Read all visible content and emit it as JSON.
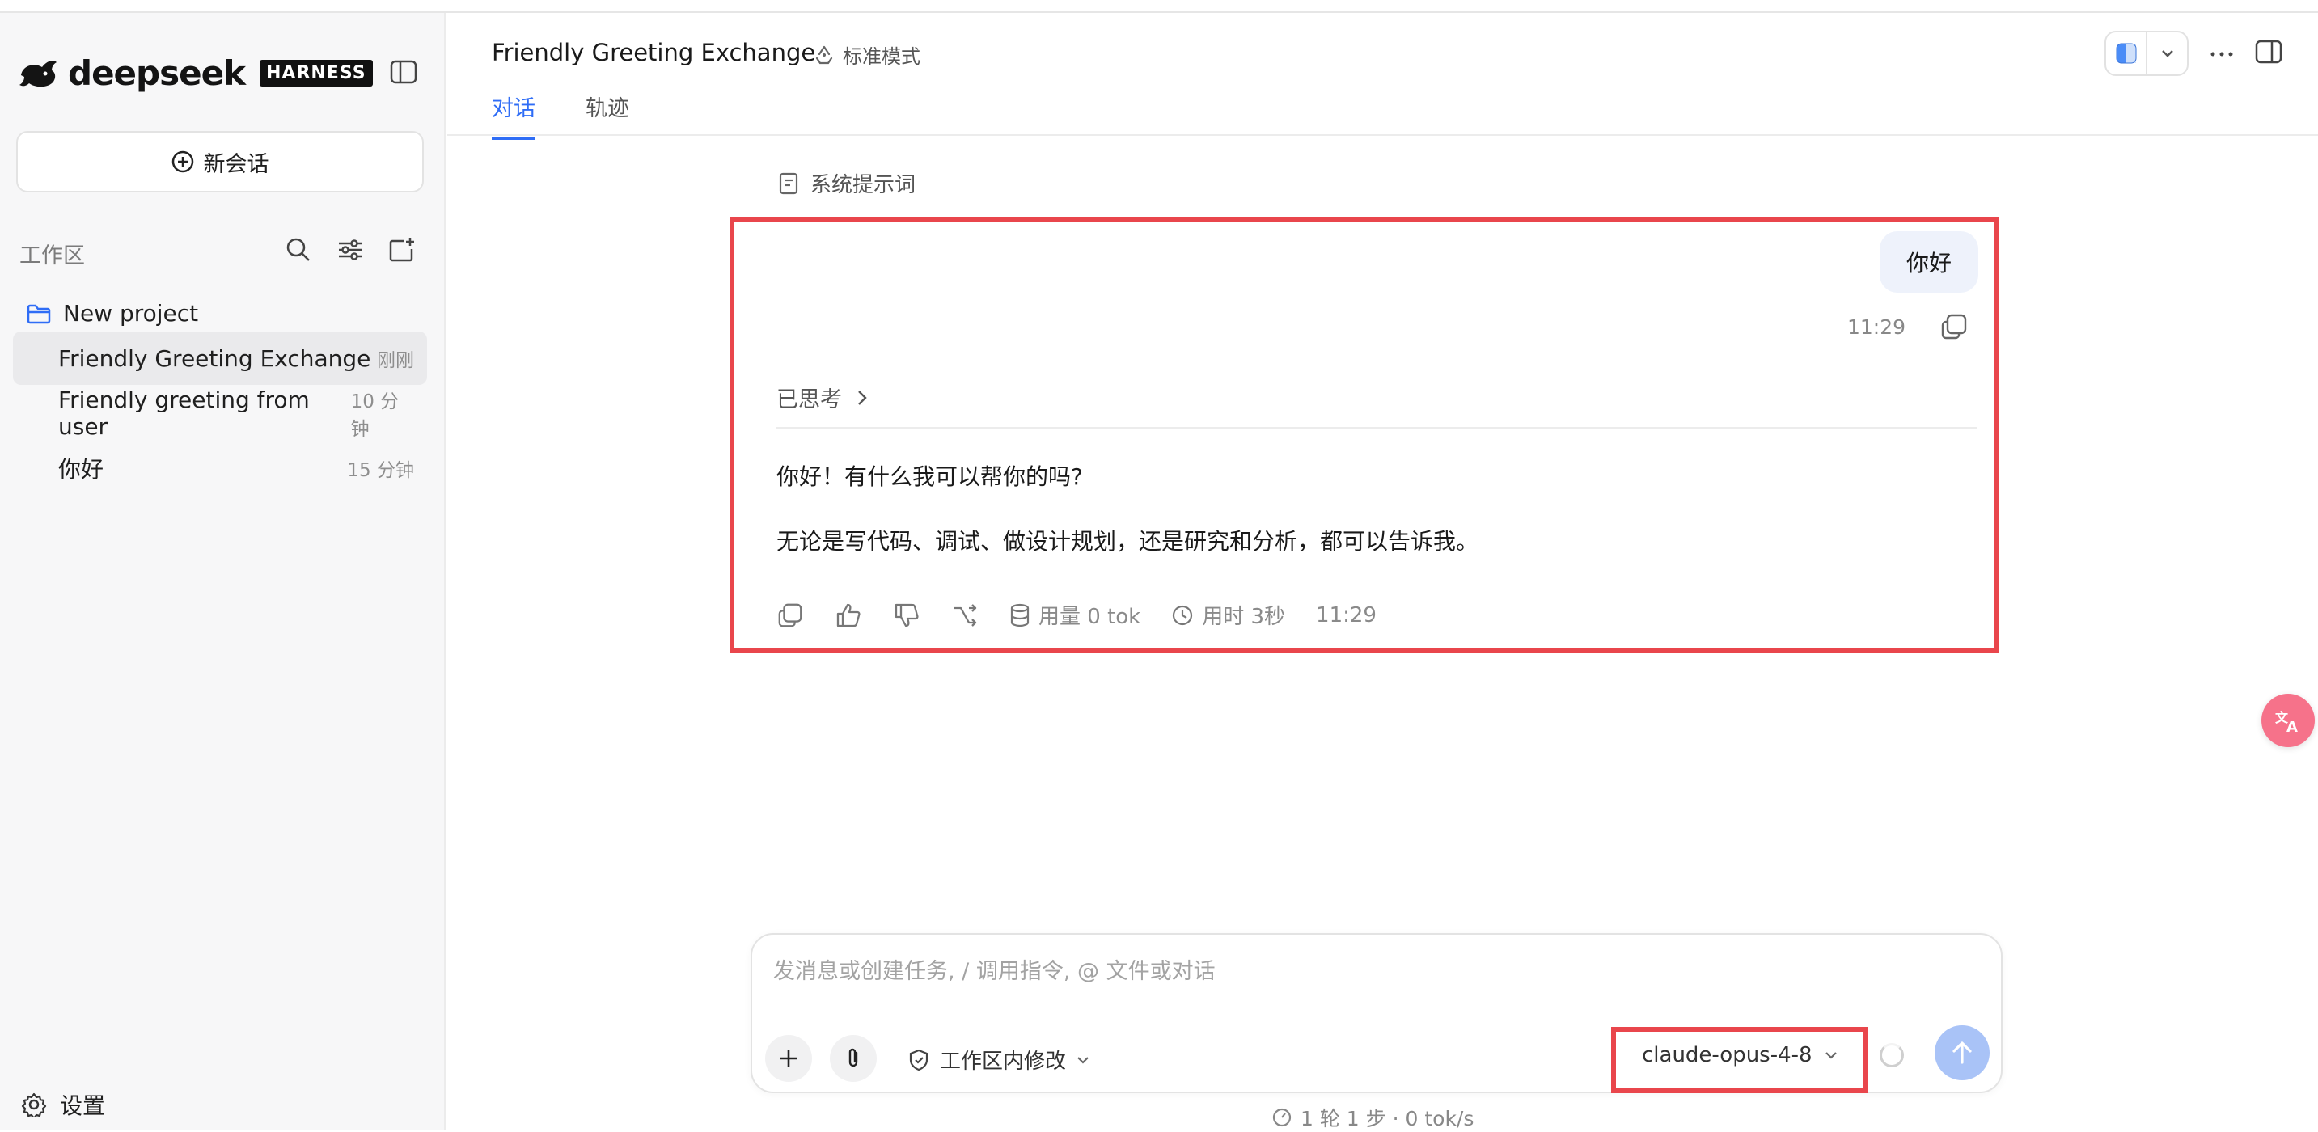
{
  "sidebar": {
    "logo_text": "deepseek",
    "logo_badge": "HARNESS",
    "new_chat_label": "新会话",
    "workspace_label": "工作区",
    "project_name": "New project",
    "conversations": [
      {
        "title": "Friendly Greeting Exchange",
        "time": "刚刚",
        "active": true
      },
      {
        "title": "Friendly greeting from user",
        "time": "10 分钟",
        "active": false
      },
      {
        "title": "你好",
        "time": "15 分钟",
        "active": false
      }
    ],
    "settings_label": "设置"
  },
  "header": {
    "title": "Friendly Greeting Exchange",
    "mode_label": "标准模式",
    "tabs": [
      {
        "label": "对话",
        "active": true
      },
      {
        "label": "轨迹",
        "active": false
      }
    ]
  },
  "chat": {
    "system_prompt_label": "系统提示词",
    "user_message": "你好",
    "user_time": "11:29",
    "thought_label": "已思考",
    "answer_lines": [
      "你好！有什么我可以帮你的吗?",
      "无论是写代码、调试、做设计规划，还是研究和分析，都可以告诉我。"
    ],
    "usage_label": "用量 0 tok",
    "duration_label": "用时 3秒",
    "answer_time": "11:29"
  },
  "composer": {
    "placeholder": "发消息或创建任务, / 调用指令, @ 文件或对话",
    "permission_label": "工作区内修改",
    "model": "claude-opus-4-8",
    "stats": "1 轮 1 步 · 0 tok/s"
  },
  "colors": {
    "accent": "#2f6df6",
    "highlight": "#e9464c",
    "send_button": "#a9c3f7",
    "translate_fab": "#f6728a"
  }
}
